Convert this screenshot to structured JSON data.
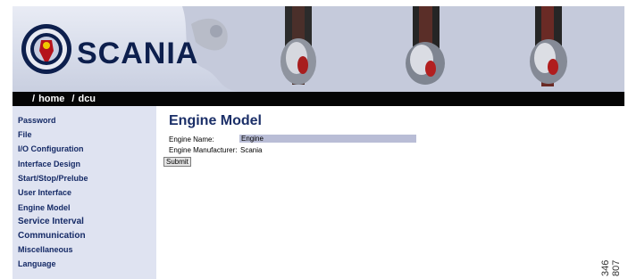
{
  "header": {
    "brand": "SCANIA"
  },
  "breadcrumb": {
    "parts": [
      "home",
      "dcu"
    ]
  },
  "sidebar": {
    "items": [
      {
        "label": "Password"
      },
      {
        "label": "File"
      },
      {
        "label": "I/O Configuration"
      },
      {
        "label": "Interface Design"
      },
      {
        "label": "Start/Stop/Prelube"
      },
      {
        "label": "User Interface"
      },
      {
        "label": "Engine Model"
      },
      {
        "label": "Service Interval"
      },
      {
        "label": "Communication"
      },
      {
        "label": "Miscellaneous"
      },
      {
        "label": "Language"
      }
    ]
  },
  "main": {
    "title": "Engine Model",
    "engine_name_label": "Engine Name:",
    "engine_name_value": "Engine",
    "engine_manufacturer_label": "Engine Manufacturer:",
    "engine_manufacturer_value": "Scania",
    "submit_label": "Submit"
  },
  "figure_number": "346 807",
  "colors": {
    "sidebar_bg": "#dfe3f1",
    "nav_text": "#152a66",
    "breadcrumb_bg": "#050505",
    "input_bg": "#b9bdd6"
  }
}
